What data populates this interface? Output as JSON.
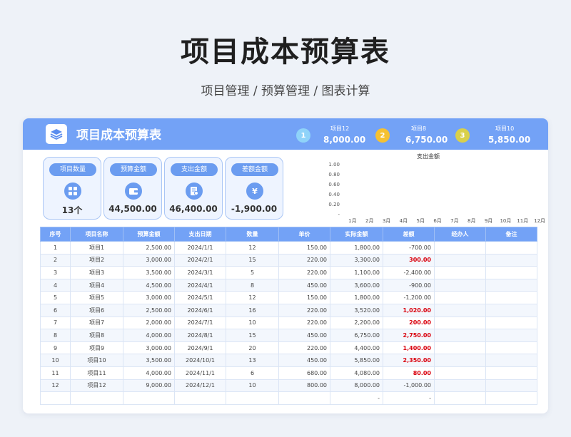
{
  "page": {
    "title": "项目成本预算表",
    "subtitle": "项目管理 / 预算管理 / 图表计算"
  },
  "header": {
    "title": "项目成本预算表",
    "top3": [
      {
        "rank": "1",
        "name": "项目12",
        "value": "8,000.00",
        "color": "#8fd3f9"
      },
      {
        "rank": "2",
        "name": "项目8",
        "value": "6,750.00",
        "color": "#f5c132"
      },
      {
        "rank": "3",
        "name": "项目10",
        "value": "5,850.00",
        "color": "#d9d04a"
      }
    ]
  },
  "stats": [
    {
      "label": "项目数量",
      "value": "13个",
      "icon": "grid-icon"
    },
    {
      "label": "预算金额",
      "value": "44,500.00",
      "icon": "wallet-icon"
    },
    {
      "label": "支出金额",
      "value": "46,400.00",
      "icon": "receipt-icon"
    },
    {
      "label": "差额金额",
      "value": "-1,900.00",
      "icon": "yen-icon"
    }
  ],
  "chart_data": {
    "type": "bar",
    "title": "支出金额",
    "categories": [
      "1月",
      "2月",
      "3月",
      "4月",
      "5月",
      "6月",
      "7月",
      "8月",
      "9月",
      "10月",
      "11月",
      "12月"
    ],
    "values": [
      0,
      0,
      0,
      0,
      0,
      0,
      0,
      0,
      0,
      0,
      0,
      0
    ],
    "y_ticks": [
      "1.00",
      "0.80",
      "0.60",
      "0.40",
      "0.20",
      "-"
    ],
    "ylim": [
      0,
      1
    ],
    "grid": false
  },
  "table": {
    "columns": [
      "序号",
      "项目名称",
      "预算金额",
      "支出日期",
      "数量",
      "单价",
      "实际金额",
      "差额",
      "经办人",
      "备注"
    ],
    "rows": [
      [
        "1",
        "项目1",
        "2,500.00",
        "2024/1/1",
        "12",
        "150.00",
        "1,800.00",
        "-700.00",
        "",
        ""
      ],
      [
        "2",
        "项目2",
        "3,000.00",
        "2024/2/1",
        "15",
        "220.00",
        "3,300.00",
        "300.00",
        "",
        ""
      ],
      [
        "3",
        "项目3",
        "3,500.00",
        "2024/3/1",
        "5",
        "220.00",
        "1,100.00",
        "-2,400.00",
        "",
        ""
      ],
      [
        "4",
        "项目4",
        "4,500.00",
        "2024/4/1",
        "8",
        "450.00",
        "3,600.00",
        "-900.00",
        "",
        ""
      ],
      [
        "5",
        "项目5",
        "3,000.00",
        "2024/5/1",
        "12",
        "150.00",
        "1,800.00",
        "-1,200.00",
        "",
        ""
      ],
      [
        "6",
        "项目6",
        "2,500.00",
        "2024/6/1",
        "16",
        "220.00",
        "3,520.00",
        "1,020.00",
        "",
        ""
      ],
      [
        "7",
        "项目7",
        "2,000.00",
        "2024/7/1",
        "10",
        "220.00",
        "2,200.00",
        "200.00",
        "",
        ""
      ],
      [
        "8",
        "项目8",
        "4,000.00",
        "2024/8/1",
        "15",
        "450.00",
        "6,750.00",
        "2,750.00",
        "",
        ""
      ],
      [
        "9",
        "项目9",
        "3,000.00",
        "2024/9/1",
        "20",
        "220.00",
        "4,400.00",
        "1,400.00",
        "",
        ""
      ],
      [
        "10",
        "项目10",
        "3,500.00",
        "2024/10/1",
        "13",
        "450.00",
        "5,850.00",
        "2,350.00",
        "",
        ""
      ],
      [
        "11",
        "项目11",
        "4,000.00",
        "2024/11/1",
        "6",
        "680.00",
        "4,080.00",
        "80.00",
        "",
        ""
      ],
      [
        "12",
        "项目12",
        "9,000.00",
        "2024/12/1",
        "10",
        "800.00",
        "8,000.00",
        "-1,000.00",
        "",
        ""
      ],
      [
        "",
        "",
        "",
        "",
        "",
        "",
        "-",
        "-",
        "",
        ""
      ]
    ]
  }
}
